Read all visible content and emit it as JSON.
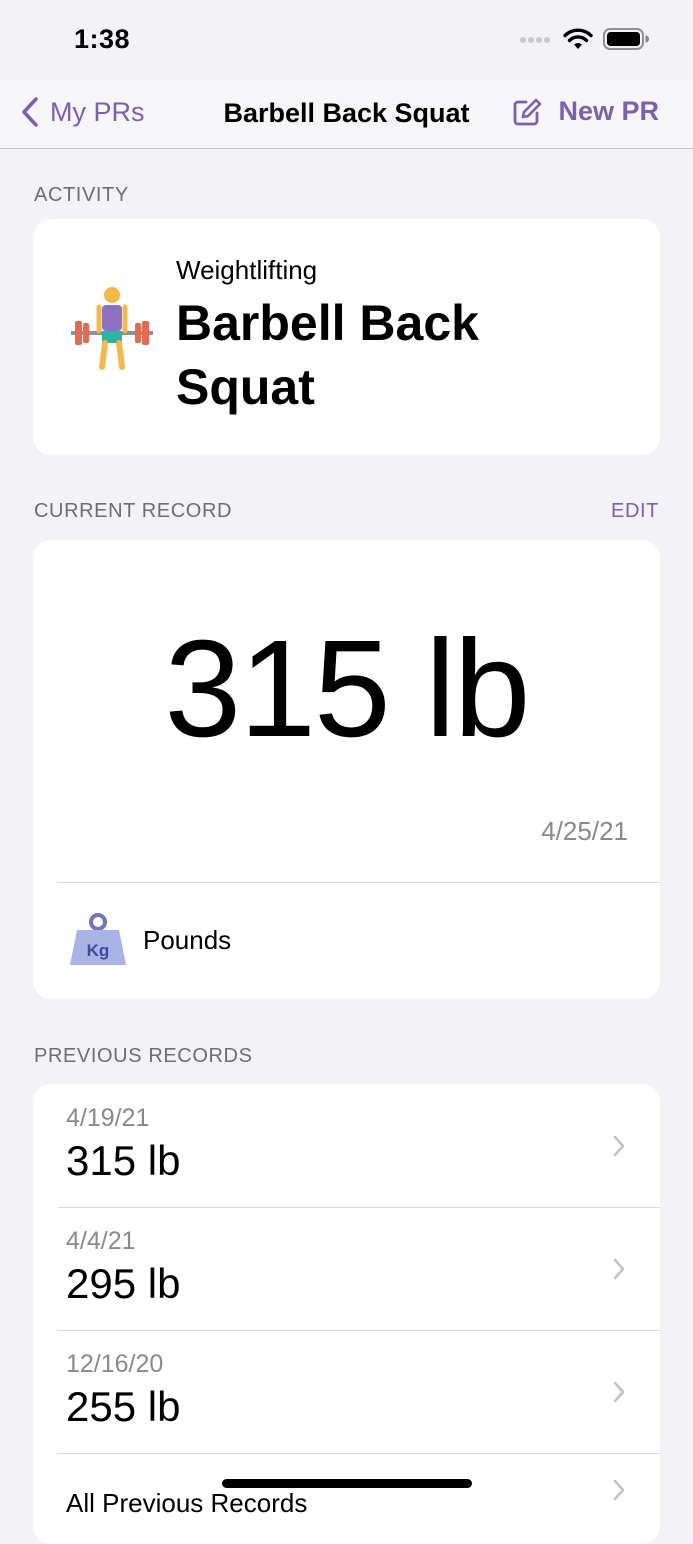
{
  "status_bar": {
    "time": "1:38"
  },
  "nav": {
    "back_label": "My PRs",
    "title": "Barbell Back Squat",
    "new_label": "New PR"
  },
  "activity": {
    "header": "ACTIVITY",
    "category": "Weightlifting",
    "name": "Barbell Back Squat",
    "icon": "weightlifter-icon"
  },
  "current_record": {
    "header": "CURRENT RECORD",
    "edit_label": "EDIT",
    "value": "315 lb",
    "date": "4/25/21",
    "unit_label": "Pounds",
    "unit_icon_text": "Kg"
  },
  "previous_records": {
    "header": "PREVIOUS RECORDS",
    "items": [
      {
        "date": "4/19/21",
        "value": "315 lb"
      },
      {
        "date": "4/4/21",
        "value": "295 lb"
      },
      {
        "date": "12/16/20",
        "value": "255 lb"
      }
    ],
    "all_label": "All Previous Records"
  },
  "colors": {
    "accent": "#7d5fb2",
    "background": "#f2f2f7",
    "secondary_text": "#8a8a8e"
  }
}
